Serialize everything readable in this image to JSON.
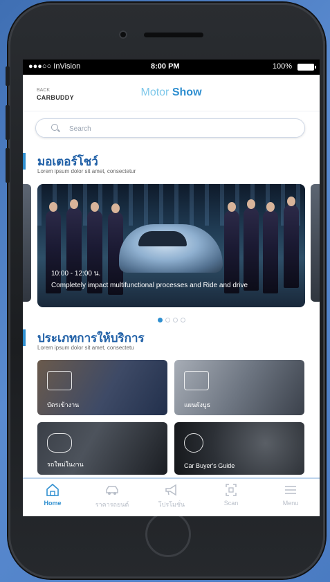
{
  "statusbar": {
    "carrier": "●●●○○ InVision",
    "time": "8:00 PM",
    "battery": "100%"
  },
  "nav": {
    "back": "BACK",
    "logo": "CARBUDDY",
    "title_part1": "Motor",
    "title_part2": "Show"
  },
  "search": {
    "placeholder": "Search"
  },
  "section_show": {
    "title": "มอเตอร์โชว์",
    "subtitle": "Lorem ipsum dolor sit amet, consectetur",
    "card": {
      "time": "10:00 - 12:00 น.",
      "description": "Completely impact multifunctional processes and Ride and drive"
    },
    "pagination": {
      "count": 4,
      "active": 0
    }
  },
  "section_services": {
    "title": "ประเภทการให้บริการ",
    "subtitle": "Lorem ipsum dolor sit amet, consectetu",
    "items": [
      {
        "label": "บัตรเข้างาน",
        "icon": "ticket-icon"
      },
      {
        "label": "แผนผังบูธ",
        "icon": "map-icon"
      },
      {
        "label": "รถใหม่ในงาน",
        "icon": "car-sparkle-icon"
      },
      {
        "label": "Car Buyer's Guide",
        "icon": "steering-wheel-icon"
      }
    ]
  },
  "tabs": [
    {
      "label": "Home",
      "icon": "home-icon",
      "active": true
    },
    {
      "label": "ราคารถยนต์",
      "icon": "car-price-icon",
      "active": false
    },
    {
      "label": "โปรโมชั่น",
      "icon": "megaphone-icon",
      "active": false
    },
    {
      "label": "Scan",
      "icon": "scan-icon",
      "active": false
    },
    {
      "label": "Menu",
      "icon": "menu-icon",
      "active": false
    }
  ],
  "colors": {
    "accent": "#2f8fd0",
    "accent_light": "#7fc8ea",
    "section_title": "#1f5fa6",
    "background": "#4a7bc2"
  }
}
